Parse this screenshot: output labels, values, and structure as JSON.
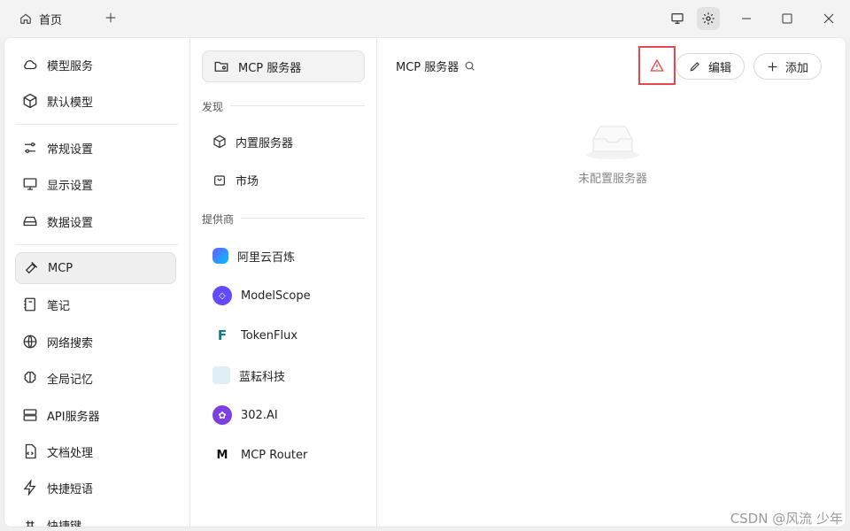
{
  "titlebar": {
    "tab_label": "首页",
    "tab_icon": "home-icon"
  },
  "sidebar": {
    "items": [
      {
        "label": "模型服务",
        "icon": "cloud-icon"
      },
      {
        "label": "默认模型",
        "icon": "cube-icon"
      },
      {
        "label": "常规设置",
        "icon": "sliders-icon"
      },
      {
        "label": "显示设置",
        "icon": "monitor-settings-icon"
      },
      {
        "label": "数据设置",
        "icon": "hard-drive-icon"
      },
      {
        "label": "MCP",
        "icon": "hammer-icon",
        "active": true
      },
      {
        "label": "笔记",
        "icon": "notebook-icon"
      },
      {
        "label": "网络搜索",
        "icon": "globe-icon"
      },
      {
        "label": "全局记忆",
        "icon": "brain-icon"
      },
      {
        "label": "API服务器",
        "icon": "server-icon"
      },
      {
        "label": "文档处理",
        "icon": "file-code-icon"
      },
      {
        "label": "快捷短语",
        "icon": "zap-icon"
      },
      {
        "label": "快捷键",
        "icon": "command-icon"
      }
    ]
  },
  "mcp_nav": {
    "servers_label": "MCP 服务器",
    "discover_label": "发现",
    "builtin_label": "内置服务器",
    "market_label": "市场",
    "providers_label": "提供商",
    "providers": [
      {
        "name": "阿里云百炼",
        "icon": "bailian-logo-icon"
      },
      {
        "name": "ModelScope",
        "icon": "modelscope-logo-icon"
      },
      {
        "name": "TokenFlux",
        "icon": "tokenflux-logo-icon"
      },
      {
        "name": "蓝耘科技",
        "icon": "lanyun-logo-icon"
      },
      {
        "name": "302.AI",
        "icon": "302ai-logo-icon"
      },
      {
        "name": "MCP Router",
        "icon": "mcp-router-logo-icon"
      }
    ]
  },
  "main": {
    "title": "MCP 服务器",
    "edit_label": "编辑",
    "add_label": "添加",
    "empty_text": "未配置服务器"
  },
  "watermark": "CSDN @风流 少年",
  "colors": {
    "warning": "#e5484d",
    "accent_purple": "#624aff"
  }
}
